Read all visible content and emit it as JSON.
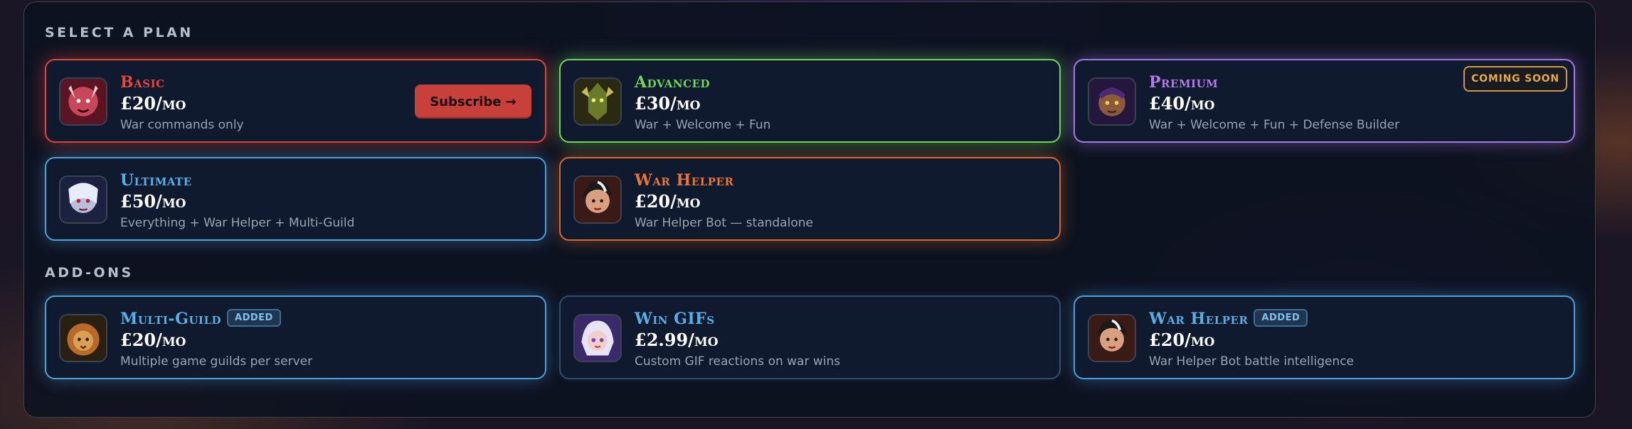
{
  "sections": {
    "plans_title": "SELECT A PLAN",
    "addons_title": "ADD-ONS"
  },
  "plans": [
    {
      "name": "Basic",
      "price": "£20/mo",
      "desc": "War commands only",
      "accent": "#e2473e",
      "action": "Subscribe →"
    },
    {
      "name": "Advanced",
      "price": "£30/mo",
      "desc": "War + Welcome + Fun",
      "accent": "#6fd35c"
    },
    {
      "name": "Premium",
      "price": "£40/mo",
      "desc": "War + Welcome + Fun + Defense Builder",
      "accent": "#b27ae8",
      "badge": "COMING SOON"
    },
    {
      "name": "Ultimate",
      "price": "£50/mo",
      "desc": "Everything + War Helper + Multi-Guild",
      "accent": "#4e9fd8"
    },
    {
      "name": "War Helper",
      "price": "£20/mo",
      "desc": "War Helper Bot — standalone",
      "accent": "#e06a34"
    }
  ],
  "addons": [
    {
      "name": "Multi-Guild",
      "badge": "ADDED",
      "price": "£20/mo",
      "desc": "Multiple game guilds per server",
      "accent": "#5aa7d8"
    },
    {
      "name": "Win GIFs",
      "price": "£2.99/mo",
      "desc": "Custom GIF reactions on war wins",
      "accent": "#5aa7d8"
    },
    {
      "name": "War Helper",
      "badge": "ADDED",
      "price": "£20/mo",
      "desc": "War Helper Bot battle intelligence",
      "accent": "#5aa7d8"
    }
  ]
}
